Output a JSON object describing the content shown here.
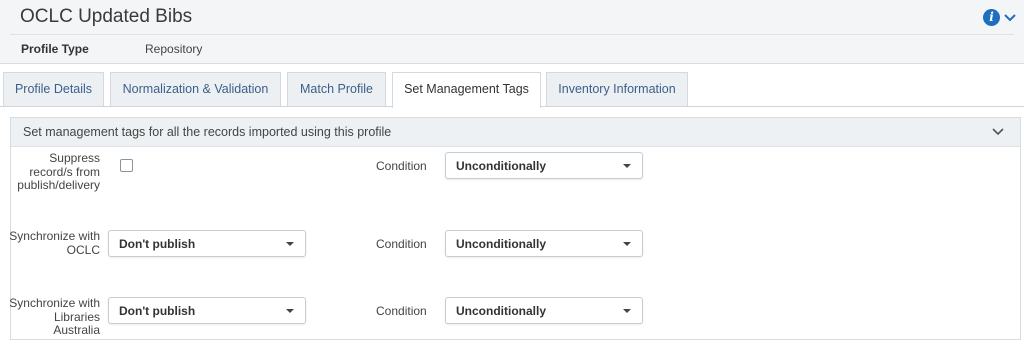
{
  "header": {
    "title": "OCLC Updated Bibs",
    "profile_type_label": "Profile Type",
    "profile_type_value": "Repository",
    "info_icon": "info-icon",
    "collapse_icon": "chevron-down-icon",
    "accent_color": "#1f6fbf"
  },
  "tabs": [
    {
      "label": "Profile Details",
      "active": false
    },
    {
      "label": "Normalization & Validation",
      "active": false
    },
    {
      "label": "Match Profile",
      "active": false
    },
    {
      "label": "Set Management Tags",
      "active": true
    },
    {
      "label": "Inventory Information",
      "active": false
    }
  ],
  "panel": {
    "title": "Set management tags for all the records imported using this profile",
    "rows": [
      {
        "label": "Suppress record/s from publish/delivery",
        "control": "checkbox",
        "checked": false,
        "condition_label": "Condition",
        "condition_value": "Unconditionally"
      },
      {
        "label": "Synchronize with OCLC",
        "control": "select",
        "value": "Don't publish",
        "condition_label": "Condition",
        "condition_value": "Unconditionally"
      },
      {
        "label": "Synchronize with Libraries Australia",
        "control": "select",
        "value": "Don't publish",
        "condition_label": "Condition",
        "condition_value": "Unconditionally"
      }
    ]
  }
}
